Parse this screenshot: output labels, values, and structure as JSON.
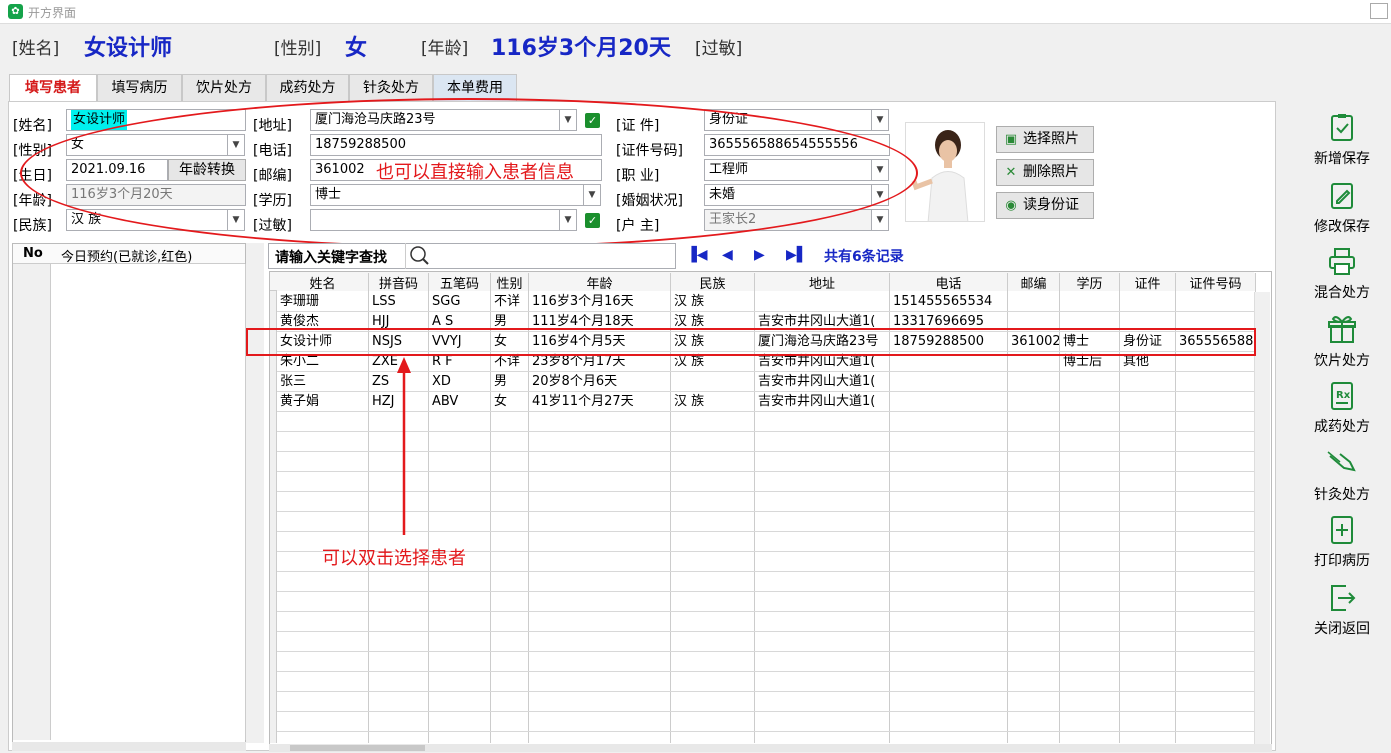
{
  "window": {
    "title": "开方界面"
  },
  "header": {
    "name_label": "[姓名]",
    "name_value": "女设计师",
    "gender_label": "[性别]",
    "gender_value": "女",
    "age_label": "[年龄]",
    "age_value": "116岁3个月20天",
    "allergy_label": "[过敏]"
  },
  "tabs": [
    "填写患者",
    "填写病历",
    "饮片处方",
    "成药处方",
    "针灸处方",
    "本单费用"
  ],
  "form": {
    "name_label": "[姓名]",
    "name_value": "女设计师",
    "gender_label": "[性别]",
    "gender_value": "女",
    "birth_label": "[生日]",
    "birth_value": "2021.09.16",
    "age_convert_button": "年龄转换",
    "age_label": "[年龄]",
    "age_value": "116岁3个月20天",
    "ethnic_label": "[民族]",
    "ethnic_value": "汉  族",
    "address_label": "[地址]",
    "address_value": "厦门海沧马庆路23号",
    "phone_label": "[电话]",
    "phone_value": "18759288500",
    "postcode_label": "[邮编]",
    "postcode_value": "361002",
    "education_label": "[学历]",
    "education_value": "博士",
    "allergy_label": "[过敏]",
    "allergy_value": "",
    "idtype_label": "[证      件]",
    "idtype_value": "身份证",
    "idno_label": "[证件号码]",
    "idno_value": "365556588654555556",
    "job_label": "[职      业]",
    "job_value": "工程师",
    "marital_label": "[婚姻状况]",
    "marital_value": "未婚",
    "household_label": "[户      主]",
    "household_value": "王家长2"
  },
  "photo_buttons": {
    "select": "选择照片",
    "delete": "删除照片",
    "read_id": "读身份证"
  },
  "annotations": {
    "input_hint": "也可以直接输入患者信息",
    "dblclick_hint": "可以双击选择患者"
  },
  "left_list": {
    "col_no": "No",
    "col_title": "今日预约(已就诊,红色)"
  },
  "search": {
    "label": "请输入关键字查找",
    "record_count": "共有6条记录"
  },
  "grid": {
    "columns": [
      "姓名",
      "拼音码",
      "五笔码",
      "性别",
      "年龄",
      "民族",
      "地址",
      "电话",
      "邮编",
      "学历",
      "证件",
      "证件号码"
    ],
    "rows": [
      [
        "李珊珊",
        "LSS",
        "SGG",
        "不详",
        "116岁3个月16天",
        "汉  族",
        "",
        "151455565534",
        "",
        "",
        "",
        ""
      ],
      [
        "黄俊杰",
        "HJJ",
        "A S",
        "男",
        "111岁4个月18天",
        "汉  族",
        "吉安市井冈山大道1(",
        "13317696695",
        "",
        "",
        "",
        ""
      ],
      [
        "女设计师",
        "NSJS",
        "VVYJ",
        "女",
        "116岁4个月5天",
        "汉  族",
        "厦门海沧马庆路23号",
        "18759288500",
        "361002",
        "博士",
        "身份证",
        "365556588"
      ],
      [
        "朱小二",
        "ZXE",
        "R F",
        "不详",
        "23岁8个月17天",
        "汉  族",
        "吉安市井冈山大道1(",
        "",
        "",
        "博士后",
        "其他",
        ""
      ],
      [
        "张三",
        "ZS",
        "XD",
        "男",
        "20岁8个月6天",
        "",
        "吉安市井冈山大道1(",
        "",
        "",
        "",
        "",
        ""
      ],
      [
        "黄子娟",
        "HZJ",
        "ABV",
        "女",
        "41岁11个月27天",
        "汉  族",
        "吉安市井冈山大道1(",
        "",
        "",
        "",
        "",
        ""
      ]
    ]
  },
  "sidebar": [
    {
      "label": "新增保存",
      "icon": "add-save-icon"
    },
    {
      "label": "修改保存",
      "icon": "edit-save-icon"
    },
    {
      "label": "混合处方",
      "icon": "printer-icon"
    },
    {
      "label": "饮片处方",
      "icon": "gift-icon"
    },
    {
      "label": "成药处方",
      "icon": "rx-icon"
    },
    {
      "label": "针灸处方",
      "icon": "acupuncture-icon"
    },
    {
      "label": "打印病历",
      "icon": "print-record-icon"
    },
    {
      "label": "关闭返回",
      "icon": "exit-icon"
    }
  ],
  "colors": {
    "accent_blue": "#1727c5",
    "annotation_red": "#e3191c",
    "side_green": "#1f8b3a"
  }
}
